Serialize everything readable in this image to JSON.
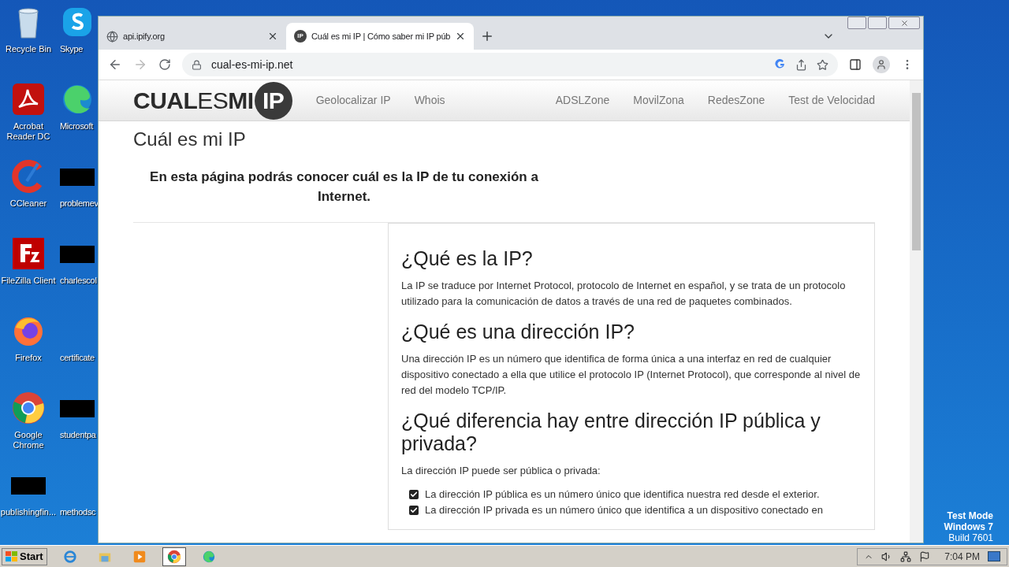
{
  "desktop": {
    "icons": [
      {
        "label": "Recycle Bin",
        "kind": "recycle-bin"
      },
      {
        "label": "Skype",
        "kind": "skype"
      },
      {
        "label": "Acrobat Reader DC",
        "kind": "acrobat"
      },
      {
        "label": "Microsoft",
        "kind": "edge"
      },
      {
        "label": "CCleaner",
        "kind": "ccleaner"
      },
      {
        "label": "problemev",
        "kind": "redacted"
      },
      {
        "label": "FileZilla Client",
        "kind": "filezilla"
      },
      {
        "label": "charlescol",
        "kind": "redacted"
      },
      {
        "label": "Firefox",
        "kind": "firefox"
      },
      {
        "label": "certificate",
        "kind": "blank"
      },
      {
        "label": "Google Chrome",
        "kind": "chrome"
      },
      {
        "label": "studentpa",
        "kind": "redacted"
      },
      {
        "label": "publishingfin...",
        "kind": "redacted"
      },
      {
        "label": "methodsc",
        "kind": "blank"
      }
    ],
    "os_notice": [
      "Test Mode",
      "Windows 7",
      "Build 7601"
    ]
  },
  "browser": {
    "tabs": [
      {
        "title": "api.ipify.org",
        "kind": "globe",
        "selected": false
      },
      {
        "title": "Cuál es mi IP | Cómo saber mi IP púb",
        "kind": "site",
        "selected": true
      }
    ],
    "favicon_text": "IP",
    "address": "cual-es-mi-ip.net"
  },
  "site": {
    "logo": [
      "CUAL",
      "ES",
      "MI",
      "IP"
    ],
    "nav_left": [
      "Geolocalizar IP",
      "Whois"
    ],
    "nav_right": [
      "ADSLZone",
      "MovilZona",
      "RedesZone",
      "Test de Velocidad"
    ],
    "title": "Cuál es mi IP",
    "intro": "En esta página podrás conocer cuál es la IP de tu conexión a Internet.",
    "sections": [
      {
        "heading": "¿Qué es la IP?",
        "paragraphs": [
          "La IP se traduce por Internet Protocol, protocolo de Internet en español, y se trata de un protocolo utilizado para la comunicación de datos a través de una red de paquetes combinados."
        ]
      },
      {
        "heading": "¿Qué es una dirección IP?",
        "paragraphs": [
          "Una dirección IP es un número que identifica de forma única a una interfaz en red de cualquier dispositivo conectado a ella que utilice el protocolo IP (Internet Protocol), que corresponde al nivel de red del modelo TCP/IP."
        ]
      },
      {
        "heading": "¿Qué diferencia hay entre dirección IP pública y privada?",
        "paragraphs": [
          "La dirección IP puede ser pública o privada:"
        ],
        "checklist": [
          {
            "text": "La dirección IP pública es un número único que identifica nuestra red desde el exterior.",
            "checked": true
          },
          {
            "text": "La dirección IP privada es un número único que identifica a un dispositivo conectado en",
            "checked": true
          }
        ]
      }
    ]
  },
  "taskbar": {
    "start": "Start",
    "apps": [
      {
        "kind": "ie",
        "selected": false
      },
      {
        "kind": "explorer",
        "selected": false
      },
      {
        "kind": "media",
        "selected": false
      },
      {
        "kind": "chrome",
        "selected": true
      },
      {
        "kind": "edge",
        "selected": false
      }
    ],
    "time": "7:04 PM"
  }
}
